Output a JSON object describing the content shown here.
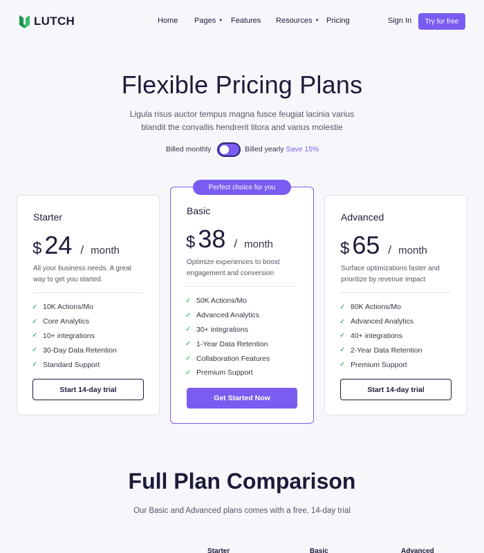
{
  "nav": {
    "brand": "LUTCH",
    "links": [
      {
        "label": "Home",
        "dropdown": false
      },
      {
        "label": "Pages",
        "dropdown": true
      },
      {
        "label": "Features",
        "dropdown": false
      },
      {
        "label": "Resources",
        "dropdown": true
      },
      {
        "label": "Pricing",
        "dropdown": false
      }
    ],
    "signin": "Sign In",
    "cta": "Try for free"
  },
  "hero": {
    "title": "Flexible Pricing Plans",
    "subtitle": "Ligula risus auctor tempus magna fusce feugiat lacinia varius blandit the convallis hendrerit litora and varius molestie"
  },
  "billing": {
    "monthly_label": "Billed monthly",
    "yearly_label": "Billed yearly",
    "save_label": "Save 15%",
    "toggle_state": "yearly"
  },
  "plans": [
    {
      "name": "Starter",
      "currency": "$",
      "price": "24",
      "slash": "/",
      "period": "month",
      "description": "All your business needs. A great way to get you started.",
      "features": [
        "10K Actions/Mo",
        "Core Analytics",
        "10+ integrations",
        "30-Day Data Retention",
        "Standard Support"
      ],
      "button": "Start 14-day trial"
    },
    {
      "name": "Basic",
      "badge": "Perfect choice for you",
      "currency": "$",
      "price": "38",
      "slash": "/",
      "period": "month",
      "description": "Optimize experiences to boost engagement and conversion",
      "features": [
        "50K Actions/Mo",
        "Advanced Analytics",
        "30+ integrations",
        "1-Year Data Retention",
        "Collaboration Features",
        "Premium Support"
      ],
      "button": "Get Started Now"
    },
    {
      "name": "Advanced",
      "currency": "$",
      "price": "65",
      "slash": "/",
      "period": "month",
      "description": "Surface optimizations faster and prioritize by revenue impact",
      "features": [
        "80K Actions/Mo",
        "Advanced Analytics",
        "40+ integrations",
        "2-Year Data Retention",
        "Premium Support"
      ],
      "button": "Start 14-day trial"
    }
  ],
  "comparison": {
    "title": "Full Plan Comparison",
    "subtitle": "Our Basic and Advanced plans comes with a free, 14-day trial",
    "columns": [
      "Starter",
      "Basic",
      "Advanced"
    ]
  },
  "colors": {
    "accent": "#7b5cf0",
    "check": "#17a34a",
    "text": "#1c1b3a",
    "background": "#f6f7fb"
  },
  "icons": [
    "logo-icon",
    "chevron-down-icon",
    "check-icon"
  ]
}
